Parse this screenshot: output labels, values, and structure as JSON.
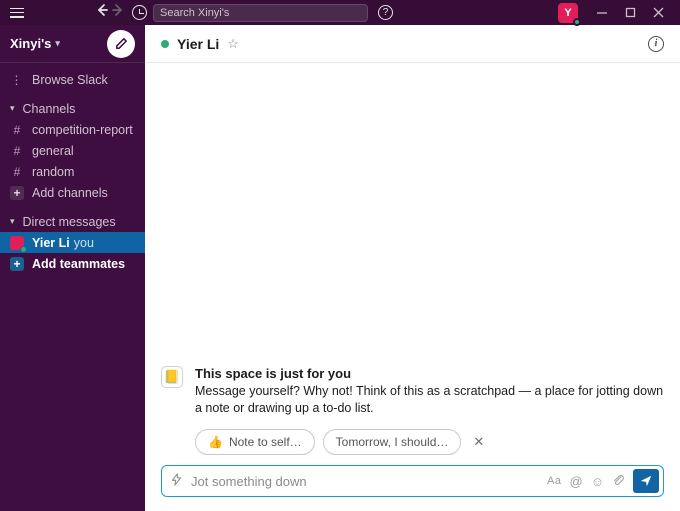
{
  "titlebar": {
    "search_placeholder": "Search Xinyi's",
    "user_initial": "Y"
  },
  "sidebar": {
    "workspace": "Xinyi's",
    "browse": "Browse Slack",
    "channels_header": "Channels",
    "channels": [
      {
        "name": "competition-report"
      },
      {
        "name": "general"
      },
      {
        "name": "random"
      }
    ],
    "add_channels": "Add channels",
    "dm_header": "Direct messages",
    "dm_self": {
      "name": "Yier Li",
      "suffix": "you"
    },
    "add_teammates": "Add teammates"
  },
  "header": {
    "title": "Yier Li"
  },
  "intro": {
    "title": "This space is just for you",
    "body": "Message yourself? Why not! Think of this as a scratchpad — a place for jotting down a note or drawing up a to-do list.",
    "icon": "📒"
  },
  "suggestions": {
    "pill1_icon": "👍",
    "pill1_text": "Note to self…",
    "pill2_text": "Tomorrow, I should…"
  },
  "composer": {
    "placeholder": "Jot something down",
    "aa": "Aa"
  }
}
